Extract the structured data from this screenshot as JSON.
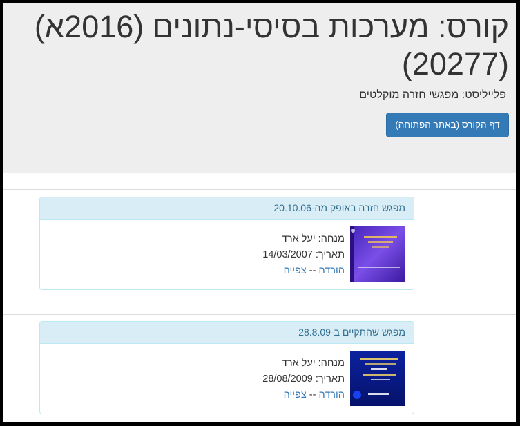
{
  "header": {
    "course_title": "קורס: מערכות בסיסי-נתונים (2016א) (20277)",
    "playlist_label": "פלייליסט:",
    "playlist_name": "מפגשי חזרה מוקלטים",
    "course_page_button": "דף הקורס (באתר הפתוחה)"
  },
  "videos": [
    {
      "title": "מפגש חזרה באופק מה-20.10.06",
      "tutor_label": "מנחה:",
      "tutor": "יעל ארד",
      "date_label": "תאריך:",
      "date": "14/03/2007",
      "download_label": "הורדה",
      "separator": "--",
      "view_label": "צפייה",
      "thumb_colors": [
        "#5a34c8",
        "#8a5cf0"
      ]
    },
    {
      "title": "מפגש שהתקיים ב-28.8.09",
      "tutor_label": "מנחה:",
      "tutor": "יעל ארד",
      "date_label": "תאריך:",
      "date": "28/08/2009",
      "download_label": "הורדה",
      "separator": "--",
      "view_label": "צפייה",
      "thumb_colors": [
        "#0a1f8a",
        "#1434c0"
      ]
    }
  ]
}
